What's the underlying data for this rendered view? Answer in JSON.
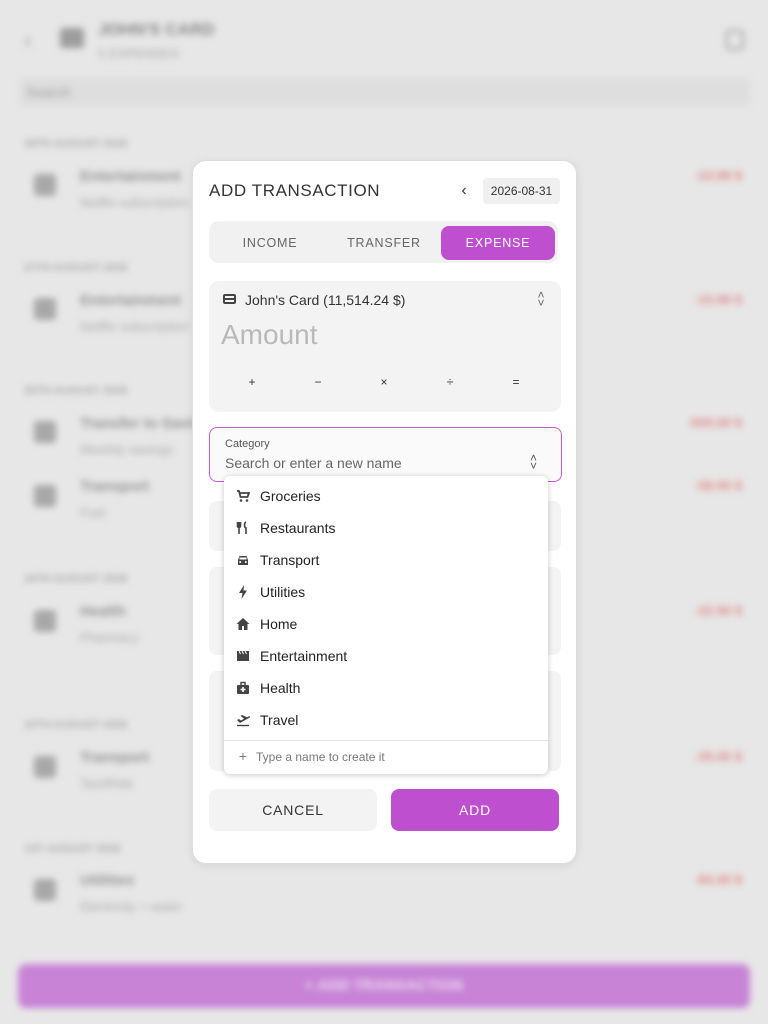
{
  "background": {
    "title": "JOHN'S CARD",
    "subtitle": "5 EXPENSES",
    "search_placeholder": "Search",
    "fab_label": "+ ADD TRANSACTION",
    "groups": [
      {
        "date": "30TH AUGUST 2026",
        "name": "Entertainment",
        "desc": "Netflix subscription",
        "amount": "-15.99 $"
      },
      {
        "date": "27TH AUGUST 2026",
        "name": "Entertainment",
        "desc": "Netflix subscription",
        "amount": "-15.99 $"
      },
      {
        "date": "25TH AUGUST 2026",
        "name": "Transfer to Savings",
        "desc": "Monthly savings",
        "amount": "-500.00 $"
      },
      {
        "date": "",
        "name": "Transport",
        "desc": "Fuel",
        "amount": "-58.50 $"
      },
      {
        "date": "16TH AUGUST 2026",
        "name": "Health",
        "desc": "Pharmacy",
        "amount": "-22.90 $"
      },
      {
        "date": "10TH AUGUST 2026",
        "name": "Transport",
        "desc": "Taxi/Ride",
        "amount": "-35.00 $"
      },
      {
        "date": "1ST AUGUST 2026",
        "name": "Utilities",
        "desc": "Electricity + water",
        "amount": "-84.40 $"
      }
    ]
  },
  "dialog": {
    "title": "ADD TRANSACTION",
    "date": "2026-08-31",
    "tabs": {
      "income": "INCOME",
      "transfer": "TRANSFER",
      "expense": "EXPENSE"
    },
    "account": "John's Card (11,514.24 $)",
    "amount_placeholder": "Amount",
    "operators": [
      "+",
      "−",
      "×",
      "÷",
      "="
    ],
    "category": {
      "label": "Category",
      "placeholder": "Search or enter a new name"
    },
    "cancel_label": "CANCEL",
    "add_label": "ADD",
    "accent_color": "#be4fcf"
  },
  "dropdown": {
    "options": [
      {
        "label": "Groceries",
        "icon": "cart-icon"
      },
      {
        "label": "Restaurants",
        "icon": "restaurant-icon"
      },
      {
        "label": "Transport",
        "icon": "car-icon"
      },
      {
        "label": "Utilities",
        "icon": "bolt-icon"
      },
      {
        "label": "Home",
        "icon": "home-icon"
      },
      {
        "label": "Entertainment",
        "icon": "movie-icon"
      },
      {
        "label": "Health",
        "icon": "medical-bag-icon"
      },
      {
        "label": "Travel",
        "icon": "plane-icon"
      }
    ],
    "hint": "Type a name to create it"
  }
}
